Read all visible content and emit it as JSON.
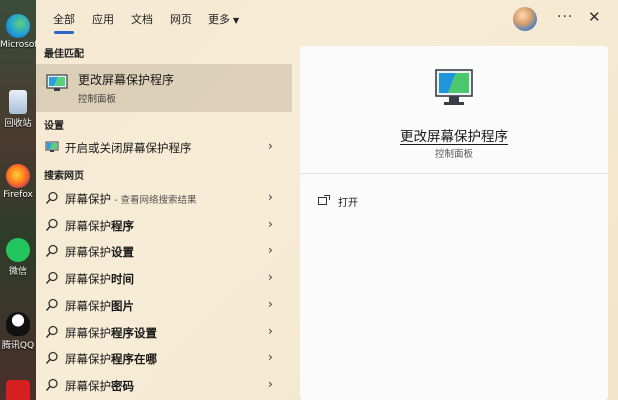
{
  "desktop": {
    "icons": [
      {
        "label": "Microsoft Edge",
        "icon": "edge-icon"
      },
      {
        "label": "回收站",
        "icon": "recycle-bin-icon"
      },
      {
        "label": "Firefox",
        "icon": "firefox-icon"
      },
      {
        "label": "微信",
        "icon": "wechat-icon"
      },
      {
        "label": "腾讯QQ",
        "icon": "qq-icon"
      },
      {
        "label": "",
        "icon": "app-icon"
      }
    ]
  },
  "tabs": [
    {
      "label": "全部"
    },
    {
      "label": "应用"
    },
    {
      "label": "文档"
    },
    {
      "label": "网页"
    },
    {
      "label": "更多"
    }
  ],
  "topbar": {
    "dots": "···",
    "close": "✕"
  },
  "sections": {
    "best_match": "最佳匹配",
    "settings": "设置",
    "web": "搜索网页"
  },
  "best_match": {
    "title": "更改屏幕保护程序",
    "subtitle": "控制面板"
  },
  "settings_items": [
    {
      "label": "开启或关闭屏幕保护程序"
    }
  ],
  "web_items": [
    {
      "prefix": "屏幕保护",
      "bold": "",
      "hint": " - 查看网络搜索结果"
    },
    {
      "prefix": "屏幕保护",
      "bold": "程序",
      "hint": ""
    },
    {
      "prefix": "屏幕保护",
      "bold": "设置",
      "hint": ""
    },
    {
      "prefix": "屏幕保护",
      "bold": "时间",
      "hint": ""
    },
    {
      "prefix": "屏幕保护",
      "bold": "图片",
      "hint": ""
    },
    {
      "prefix": "屏幕保护",
      "bold": "程序设置",
      "hint": ""
    },
    {
      "prefix": "屏幕保护",
      "bold": "程序在哪",
      "hint": ""
    },
    {
      "prefix": "屏幕保护",
      "bold": "密码",
      "hint": ""
    }
  ],
  "detail": {
    "title": "更改屏幕保护程序",
    "subtitle": "控制面板",
    "actions": [
      {
        "label": "打开",
        "icon": "open-icon"
      }
    ]
  },
  "colors": {
    "accent": "#2a67c9"
  }
}
